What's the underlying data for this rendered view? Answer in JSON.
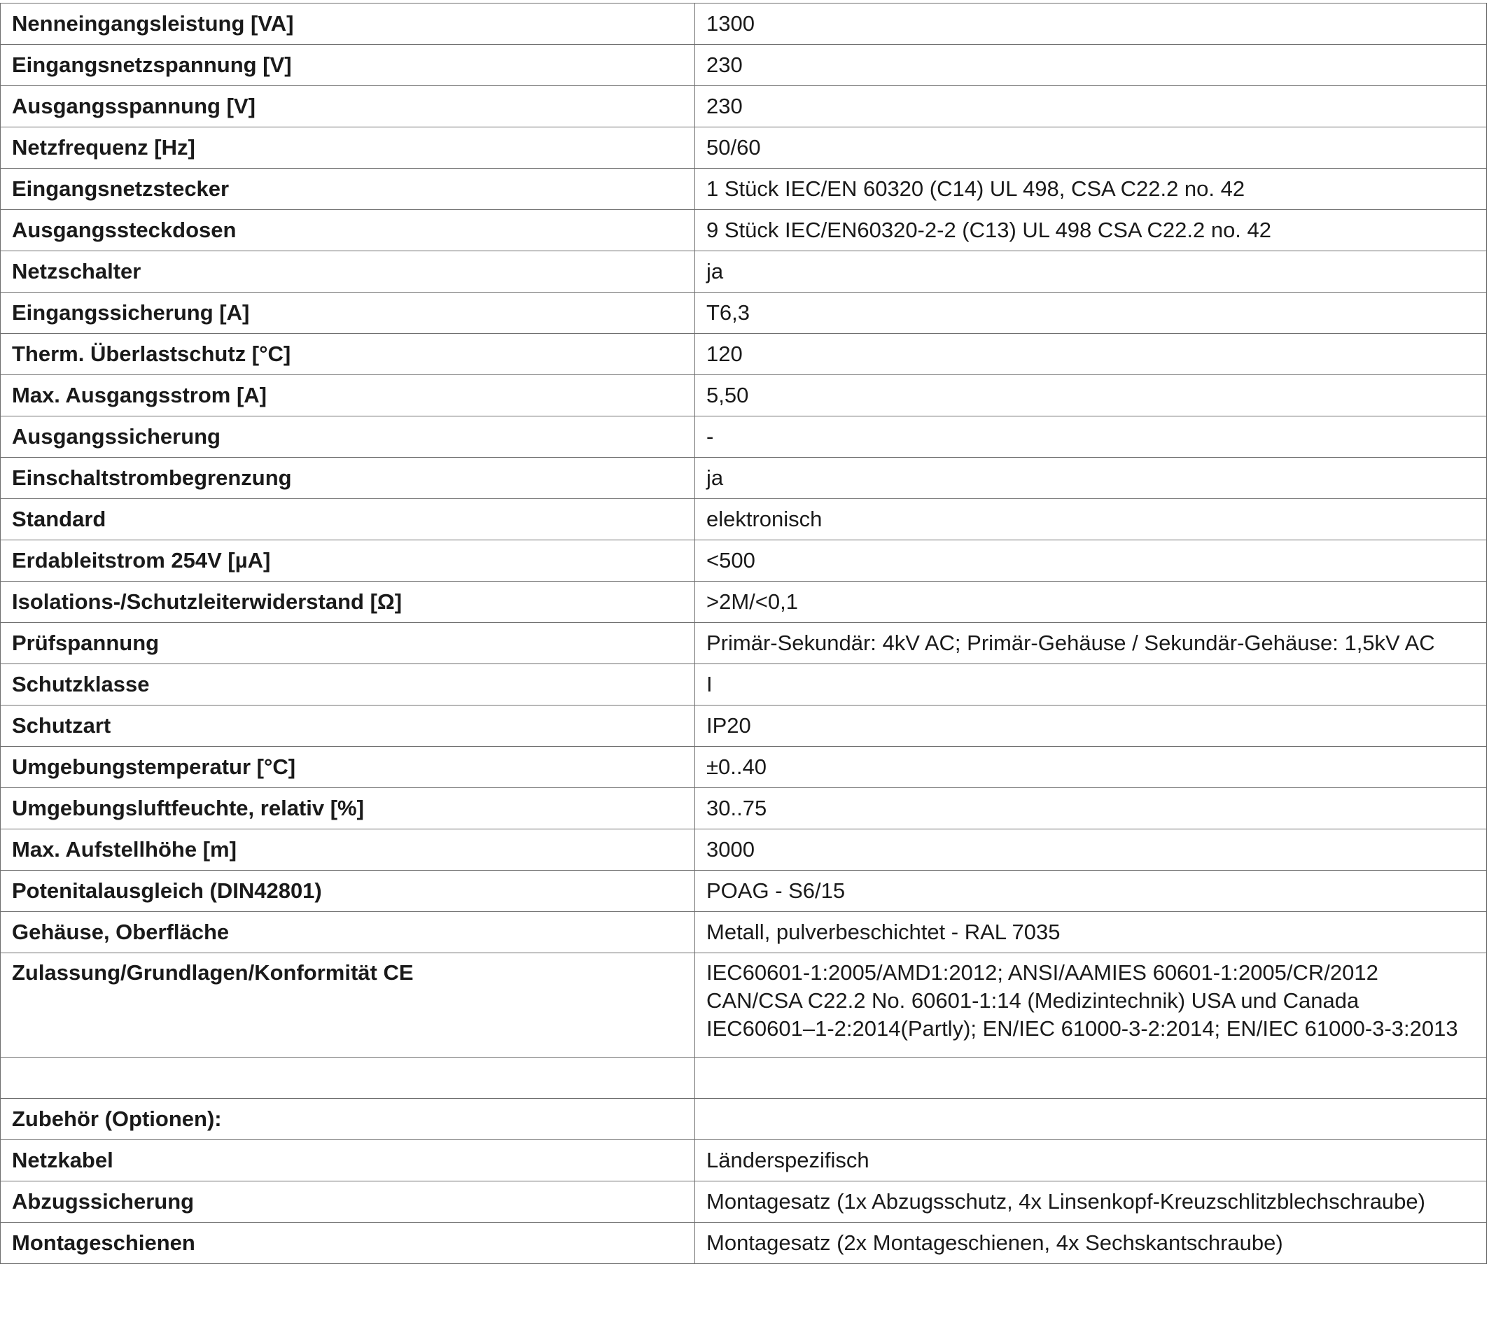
{
  "spec_rows": [
    {
      "label": "Nenneingangsleistung [VA]",
      "value": "1300"
    },
    {
      "label": "Eingangsnetzspannung [V]",
      "value": "230"
    },
    {
      "label": "Ausgangsspannung [V]",
      "value": "230"
    },
    {
      "label": "Netzfrequenz [Hz]",
      "value": "50/60"
    },
    {
      "label": "Eingangsnetzstecker",
      "value": "1 Stück IEC/EN 60320 (C14) UL 498, CSA C22.2 no. 42"
    },
    {
      "label": "Ausgangssteckdosen",
      "value": "9 Stück IEC/EN60320-2-2 (C13) UL 498 CSA C22.2 no. 42"
    },
    {
      "label": "Netzschalter",
      "value": "ja"
    },
    {
      "label": "Eingangssicherung [A]",
      "value": "T6,3"
    },
    {
      "label": "Therm. Überlastschutz [°C]",
      "value": "120"
    },
    {
      "label": "Max. Ausgangsstrom [A]",
      "value": "5,50"
    },
    {
      "label": "Ausgangssicherung",
      "value": "-"
    },
    {
      "label": "Einschaltstrombegrenzung",
      "value": "ja"
    },
    {
      "label": "Standard",
      "value": "elektronisch"
    },
    {
      "label": "Erdableitstrom 254V [µA]",
      "value": "<500"
    },
    {
      "label": "Isolations-/Schutzleiterwiderstand [Ω]",
      "value": ">2M/<0,1"
    },
    {
      "label": "Prüfspannung",
      "value": "Primär-Sekundär: 4kV AC; Primär-Gehäuse / Sekundär-Gehäuse: 1,5kV AC"
    },
    {
      "label": "Schutzklasse",
      "value": "I"
    },
    {
      "label": "Schutzart",
      "value": "IP20"
    },
    {
      "label": "Umgebungstemperatur [°C]",
      "value": "±0..40"
    },
    {
      "label": "Umgebungsluftfeuchte, relativ [%]",
      "value": "30..75"
    },
    {
      "label": "Max. Aufstellhöhe [m]",
      "value": "3000"
    },
    {
      "label": "Potenitalausgleich (DIN42801)",
      "value": "POAG - S6/15"
    },
    {
      "label": "Gehäuse, Oberfläche",
      "value": "Metall, pulverbeschichtet - RAL 7035"
    }
  ],
  "approval_row": {
    "label": "Zulassung/Grundlagen/Konformität CE",
    "lines": [
      "IEC60601-1:2005/AMD1:2012; ANSI/AAMIES 60601-1:2005/CR/2012",
      "CAN/CSA C22.2 No. 60601-1:14 (Medizintechnik) USA und Canada",
      "IEC60601–1-2:2014(Partly); EN/IEC 61000-3-2:2014; EN/IEC 61000-3-3:2013"
    ]
  },
  "empty_row": {
    "label": "",
    "value": ""
  },
  "accessories_header": {
    "label": "Zubehör (Optionen):",
    "value": ""
  },
  "accessory_rows": [
    {
      "label": "Netzkabel",
      "value": "Länderspezifisch"
    },
    {
      "label": "Abzugssicherung",
      "value": "Montagesatz (1x Abzugsschutz, 4x Linsenkopf-Kreuzschlitzblechschraube)"
    },
    {
      "label": "Montageschienen",
      "value": "Montagesatz (2x Montageschienen, 4x Sechskantschraube)"
    }
  ]
}
